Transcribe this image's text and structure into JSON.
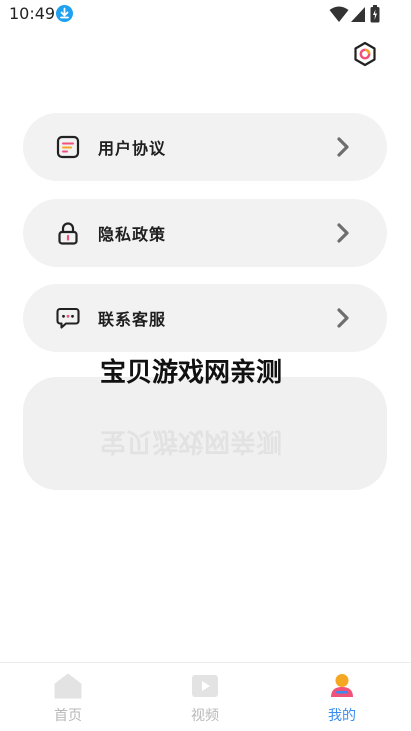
{
  "status_bar": {
    "time": "10:49"
  },
  "menu": [
    {
      "label": "用户协议",
      "icon": "document-icon"
    },
    {
      "label": "隐私政策",
      "icon": "lock-icon"
    },
    {
      "label": "联系客服",
      "icon": "chat-icon"
    }
  ],
  "watermark": "宝贝游戏网亲测",
  "bottom_nav": [
    {
      "label": "首页",
      "icon": "home-icon",
      "active": false
    },
    {
      "label": "视频",
      "icon": "video-icon",
      "active": false
    },
    {
      "label": "我的",
      "icon": "profile-icon",
      "active": true
    }
  ],
  "colors": {
    "accent": "#3a8df0",
    "card_bg": "#f2f2f2",
    "inactive_nav": "#b8b8b8",
    "download_badge": "#1ea1f1"
  }
}
